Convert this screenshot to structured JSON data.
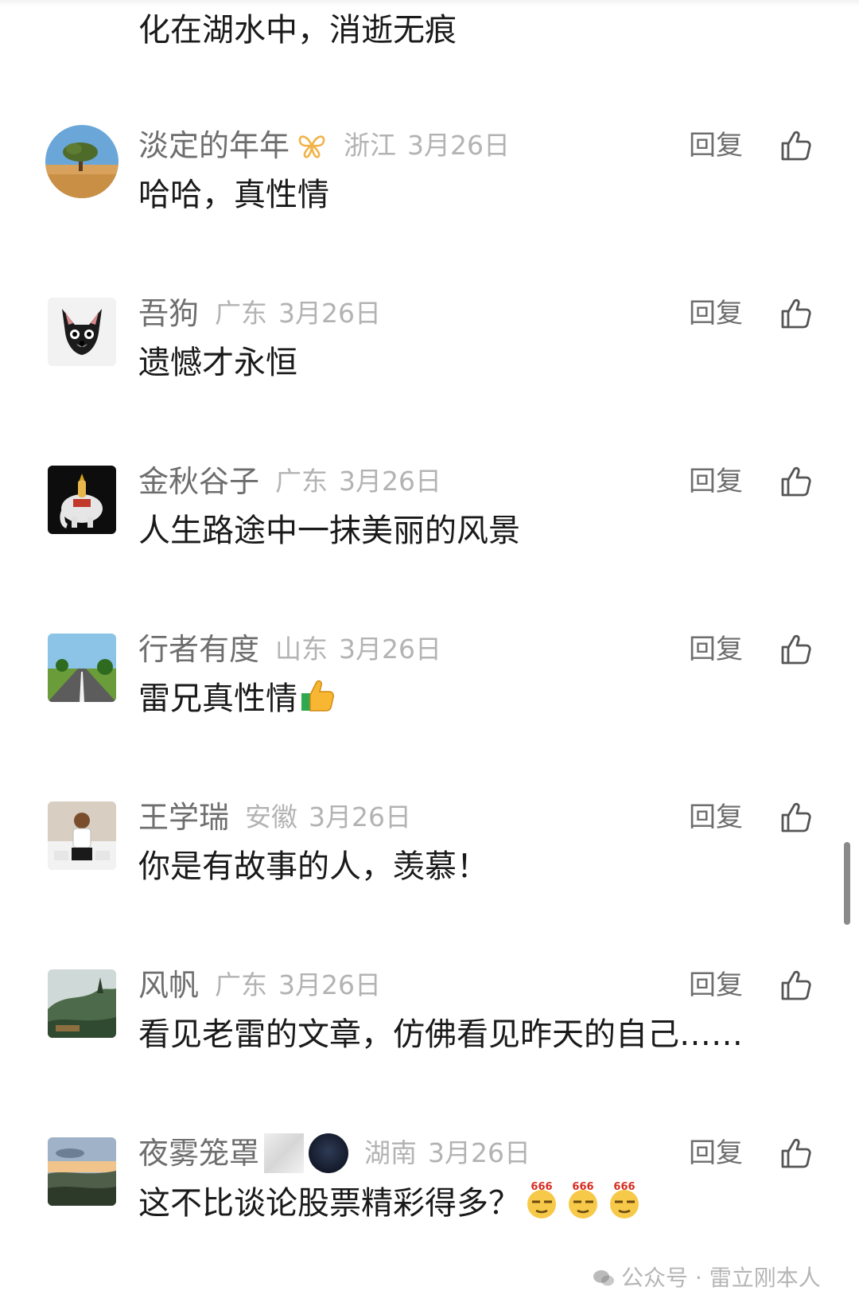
{
  "top_text": "化在湖水中，消逝无痕",
  "reply_label": "回复",
  "comments": [
    {
      "nickname": "淡定的年年",
      "location": "浙江",
      "date": "3月26日",
      "text": "哈哈，真性情",
      "avatar": "desert-tree-avatar",
      "badge": "butterfly-badge"
    },
    {
      "nickname": "吾狗",
      "location": "广东",
      "date": "3月26日",
      "text": "遗憾才永恒",
      "avatar": "dog-avatar"
    },
    {
      "nickname": "金秋谷子",
      "location": "广东",
      "date": "3月26日",
      "text": "人生路途中一抹美丽的风景",
      "avatar": "elephant-avatar"
    },
    {
      "nickname": "行者有度",
      "location": "山东",
      "date": "3月26日",
      "text": "雷兄真性情",
      "avatar": "road-avatar",
      "emoji": "thumbs-up-emoji"
    },
    {
      "nickname": "王学瑞",
      "location": "安徽",
      "date": "3月26日",
      "text": "你是有故事的人，羡慕！",
      "avatar": "person-avatar"
    },
    {
      "nickname": "风帆",
      "location": "广东",
      "date": "3月26日",
      "text": "看见老雷的文章，仿佛看见昨天的自己……",
      "avatar": "landscape-avatar"
    },
    {
      "nickname": "夜雾笼罩",
      "location": "湖南",
      "date": "3月26日",
      "text": "这不比谈论股票精彩得多？",
      "avatar": "sunset-avatar",
      "emoji": "666-emoji"
    }
  ],
  "watermark": "公众号 · 雷立刚本人",
  "emoji_666_label": "666",
  "colors": {
    "text": "#1a1a1a",
    "nickname": "#6e6e6e",
    "meta": "#b3b3b3",
    "butterfly": "#f0b34a"
  }
}
